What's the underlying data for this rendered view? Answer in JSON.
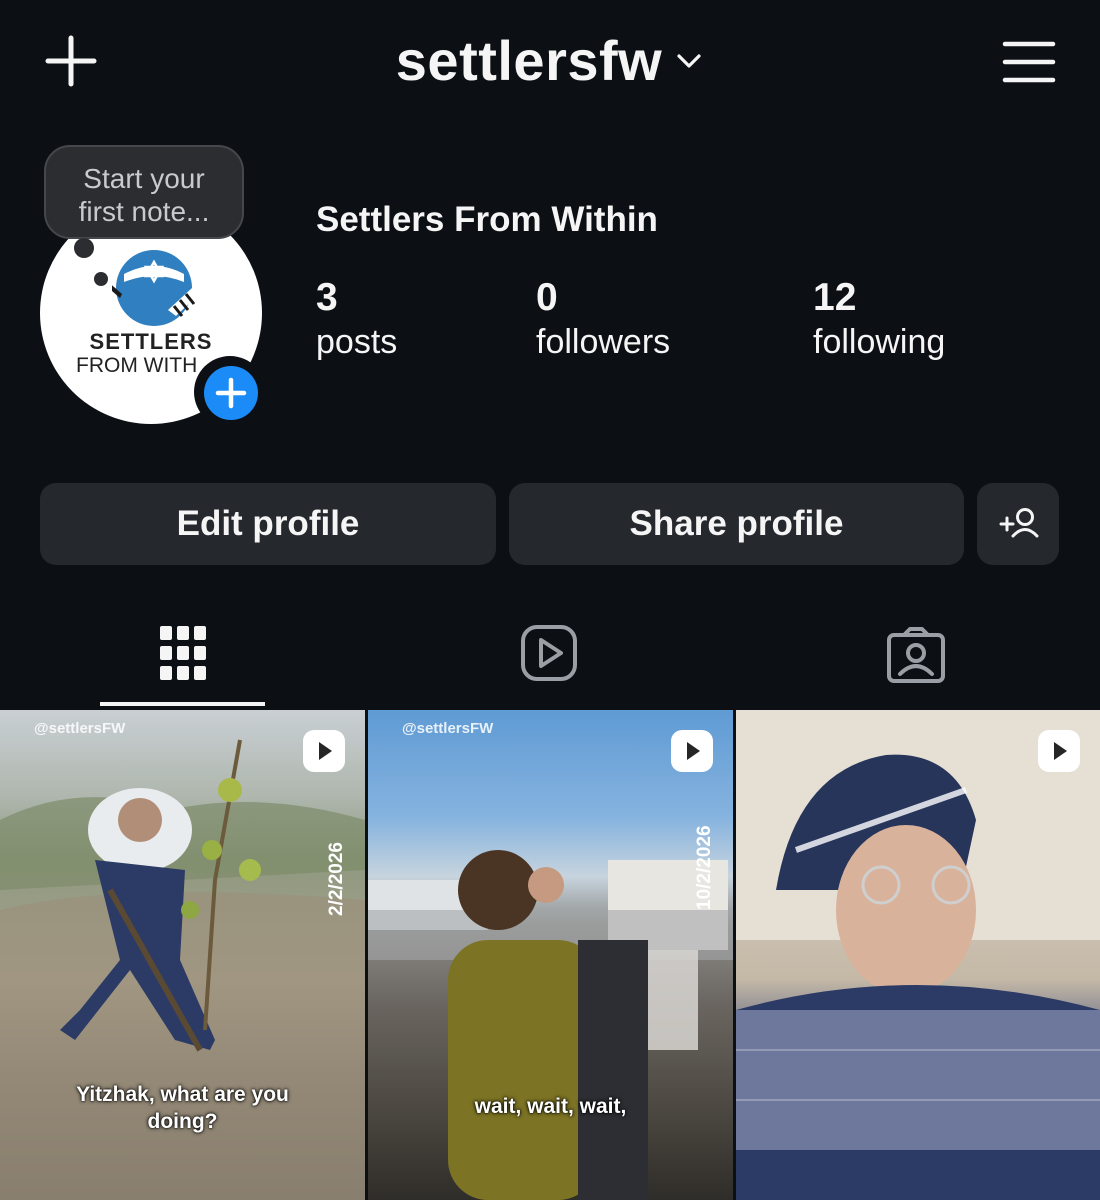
{
  "header": {
    "username": "settlersfw"
  },
  "note_bubble": {
    "line1": "Start your",
    "line2": "first note..."
  },
  "avatar": {
    "line1": "SETTLERS",
    "line2": "FROM WITH"
  },
  "profile": {
    "display_name": "Settlers From Within",
    "stats": [
      {
        "value": "3",
        "label": "posts"
      },
      {
        "value": "0",
        "label": "followers"
      },
      {
        "value": "12",
        "label": "following"
      }
    ]
  },
  "actions": {
    "edit_label": "Edit profile",
    "share_label": "Share profile"
  },
  "tabs": [
    {
      "icon": "grid-icon",
      "active": true
    },
    {
      "icon": "reels-icon",
      "active": false
    },
    {
      "icon": "tagged-icon",
      "active": false
    }
  ],
  "posts": [
    {
      "handle": "@settlersFW",
      "date": "2/2/2026",
      "caption_line1": "Yitzhak, what are you",
      "caption_line2": "doing?"
    },
    {
      "handle": "@settlersFW",
      "date": "10/2/2026",
      "caption_line1": "wait, wait, wait,",
      "caption_line2": ""
    },
    {
      "handle": "",
      "date": "",
      "caption_line1": "",
      "caption_line2": ""
    }
  ],
  "colors": {
    "background": "#0c1014",
    "button": "#25292e",
    "accent_blue": "#1b8cf7",
    "text": "#f5f5f5"
  }
}
